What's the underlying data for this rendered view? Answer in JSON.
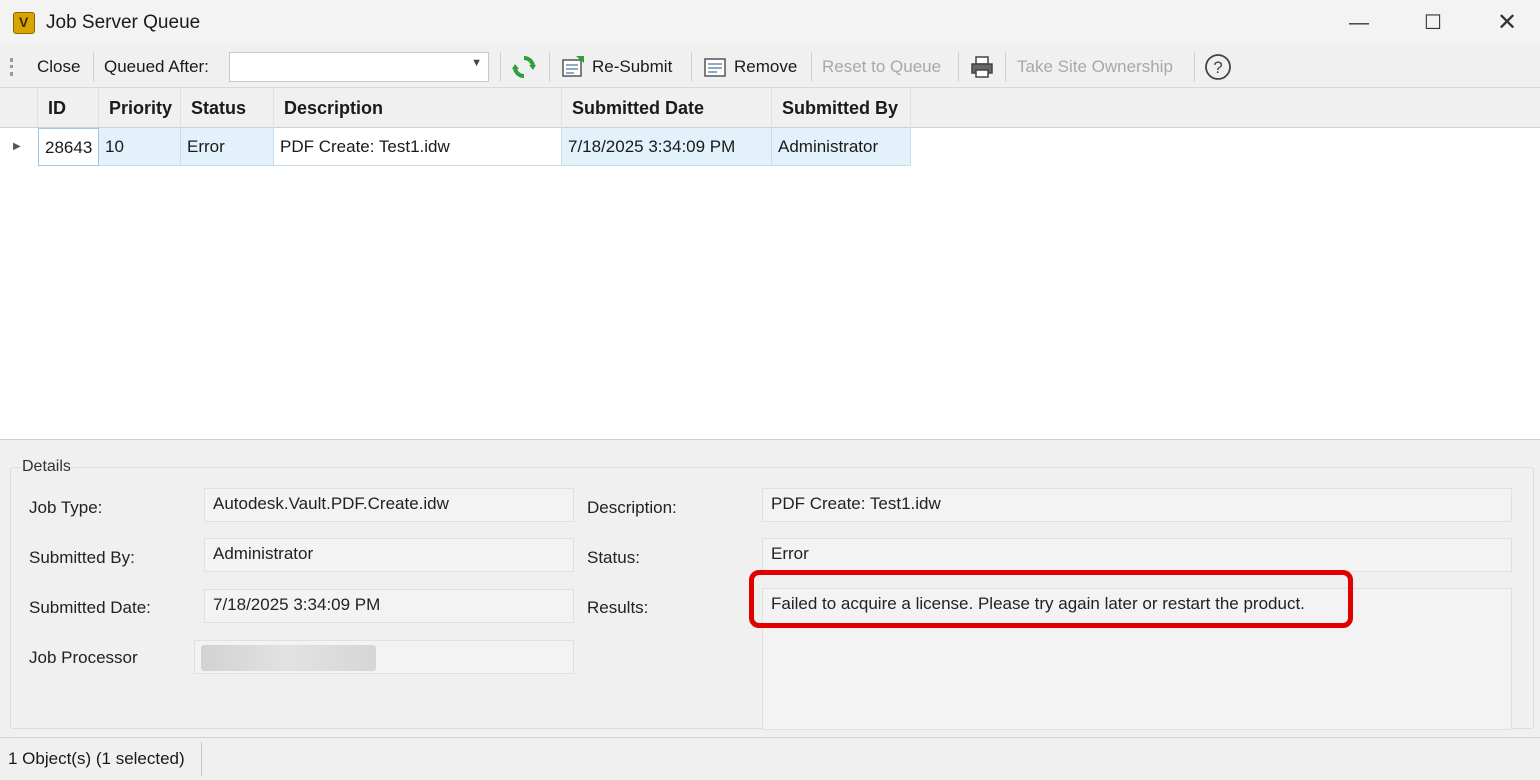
{
  "window": {
    "title": "Job Server Queue",
    "minimize_glyph": "—",
    "maximize_glyph": "☐",
    "close_glyph": "✕"
  },
  "toolbar": {
    "close_label": "Close",
    "queued_after_label": "Queued After:",
    "queued_after_value": "",
    "refresh_icon": "refresh-icon",
    "resubmit_label": "Re-Submit",
    "remove_label": "Remove",
    "reset_label": "Reset to Queue",
    "print_icon": "printer-icon",
    "take_ownership_label": "Take Site Ownership",
    "help_glyph": "?"
  },
  "grid": {
    "columns": [
      "ID",
      "Priority",
      "Status",
      "Description",
      "Submitted Date",
      "Submitted By"
    ],
    "rows": [
      {
        "id": "28643",
        "priority": "10",
        "status": "Error",
        "description": "PDF Create: Test1.idw",
        "submitted_date": "7/18/2025 3:34:09 PM",
        "submitted_by": "Administrator"
      }
    ]
  },
  "details": {
    "group_title": "Details",
    "job_type_label": "Job Type:",
    "job_type_value": "Autodesk.Vault.PDF.Create.idw",
    "submitted_by_label": "Submitted By:",
    "submitted_by_value": "Administrator",
    "submitted_date_label": "Submitted Date:",
    "submitted_date_value": "7/18/2025 3:34:09 PM",
    "job_processor_label": "Job Processor",
    "description_label": "Description:",
    "description_value": "PDF Create: Test1.idw",
    "status_label": "Status:",
    "status_value": "Error",
    "results_label": "Results:",
    "results_value": "Failed to acquire a license. Please try again later or restart the product."
  },
  "statusbar": {
    "text": "1 Object(s) (1 selected)"
  },
  "colors": {
    "selection": "#e3f1fb",
    "highlight": "#e00000",
    "refresh": "#2e9e3a"
  }
}
